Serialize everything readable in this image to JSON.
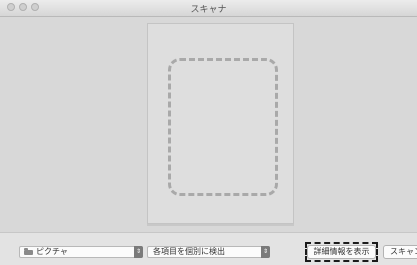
{
  "window": {
    "title": "スキャナ"
  },
  "toolbar": {
    "destination": {
      "selected": "ピクチャ",
      "icon": "folder-icon"
    },
    "scan_mode": {
      "selected": "各項目を個別に検出"
    },
    "show_details_label": "詳細情報を表示",
    "scan_label": "スキャン"
  }
}
